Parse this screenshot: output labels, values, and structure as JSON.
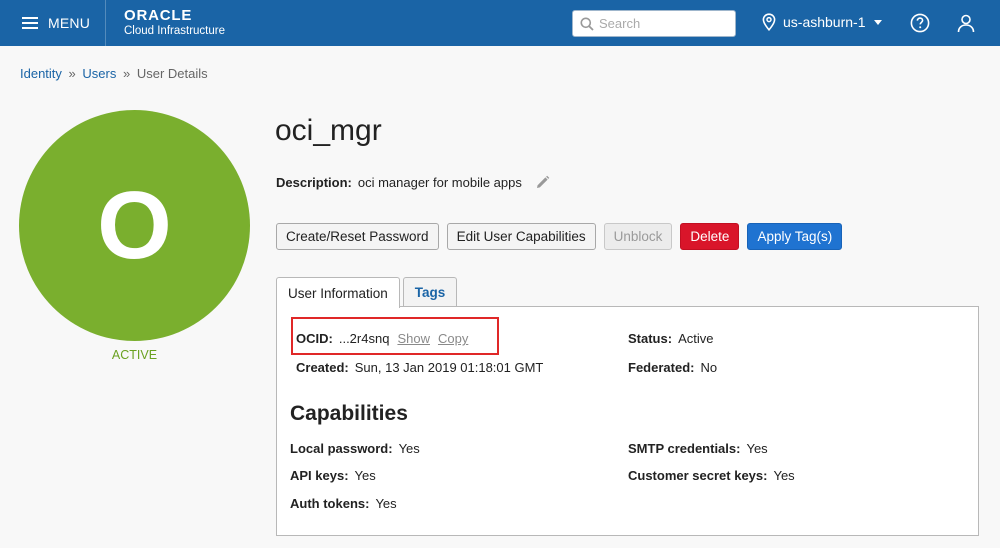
{
  "topbar": {
    "menu_label": "MENU",
    "brand_top": "ORACLE",
    "brand_sub": "Cloud Infrastructure",
    "search_placeholder": "Search",
    "region": "us-ashburn-1",
    "icons": [
      "hamburger-icon",
      "search-icon",
      "location-pin-icon",
      "chevron-down-icon",
      "help-icon",
      "user-icon"
    ]
  },
  "breadcrumb": {
    "items": [
      "Identity",
      "Users"
    ],
    "current": "User Details",
    "separator": "»"
  },
  "avatar": {
    "initial": "O",
    "status": "ACTIVE",
    "color": "#7aaf2e"
  },
  "user": {
    "name": "oci_mgr",
    "description_label": "Description:",
    "description": "oci manager for mobile apps"
  },
  "actions": {
    "reset_password": "Create/Reset Password",
    "edit_capabilities": "Edit User Capabilities",
    "unblock": "Unblock",
    "delete": "Delete",
    "apply_tags": "Apply Tag(s)"
  },
  "tabs": [
    {
      "label": "User Information",
      "active": true
    },
    {
      "label": "Tags",
      "active": false
    }
  ],
  "info": {
    "ocid_label": "OCID:",
    "ocid_value": "...2r4snq",
    "show_link": "Show",
    "copy_link": "Copy",
    "created_label": "Created:",
    "created_value": "Sun, 13 Jan 2019 01:18:01 GMT",
    "status_label": "Status:",
    "status_value": "Active",
    "federated_label": "Federated:",
    "federated_value": "No"
  },
  "capabilities": {
    "title": "Capabilities",
    "local_password_label": "Local password:",
    "local_password_value": "Yes",
    "api_keys_label": "API keys:",
    "api_keys_value": "Yes",
    "auth_tokens_label": "Auth tokens:",
    "auth_tokens_value": "Yes",
    "smtp_label": "SMTP credentials:",
    "smtp_value": "Yes",
    "customer_secret_label": "Customer secret keys:",
    "customer_secret_value": "Yes"
  },
  "colors": {
    "header": "#1a64a6",
    "danger": "#d9152a",
    "primary": "#1f73d1",
    "highlight": "#e02828"
  }
}
